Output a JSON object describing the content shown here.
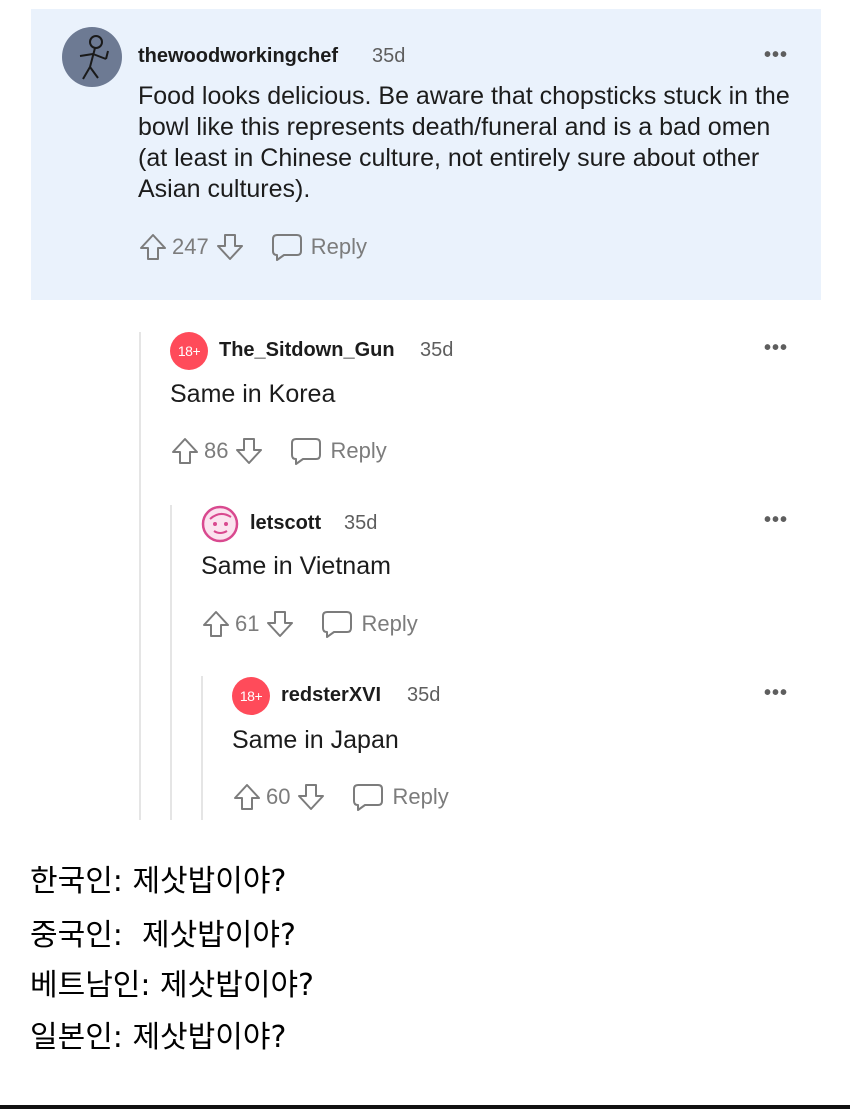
{
  "comments": [
    {
      "username": "thewoodworkingchef",
      "age": "35d",
      "more": "•••",
      "text": "Food looks delicious. Be aware that chopsticks stuck in the bowl like this represents death/funeral and is a bad omen (at least in Chinese culture, not entirely sure about other Asian cultures).",
      "votes": "247",
      "reply_label": "Reply"
    },
    {
      "username": "The_Sitdown_Gun",
      "age": "35d",
      "more": "•••",
      "avatar_badge": "18+",
      "text": "Same in Korea",
      "votes": "86",
      "reply_label": "Reply"
    },
    {
      "username": "letscott",
      "age": "35d",
      "more": "•••",
      "text": "Same in Vietnam",
      "votes": "61",
      "reply_label": "Reply"
    },
    {
      "username": "redsterXVI",
      "age": "35d",
      "more": "•••",
      "avatar_badge": "18+",
      "text": "Same in Japan",
      "votes": "60",
      "reply_label": "Reply"
    }
  ],
  "caption": [
    "한국인: 제삿밥이야?",
    "중국인:  제삿밥이야?",
    "베트남인: 제삿밥이야?",
    "일본인: 제삿밥이야?"
  ],
  "colors": {
    "highlight_bg": "#eaf2fc",
    "nsfw_badge": "#ff4b5a",
    "meta_gray": "#7c7c7c"
  }
}
